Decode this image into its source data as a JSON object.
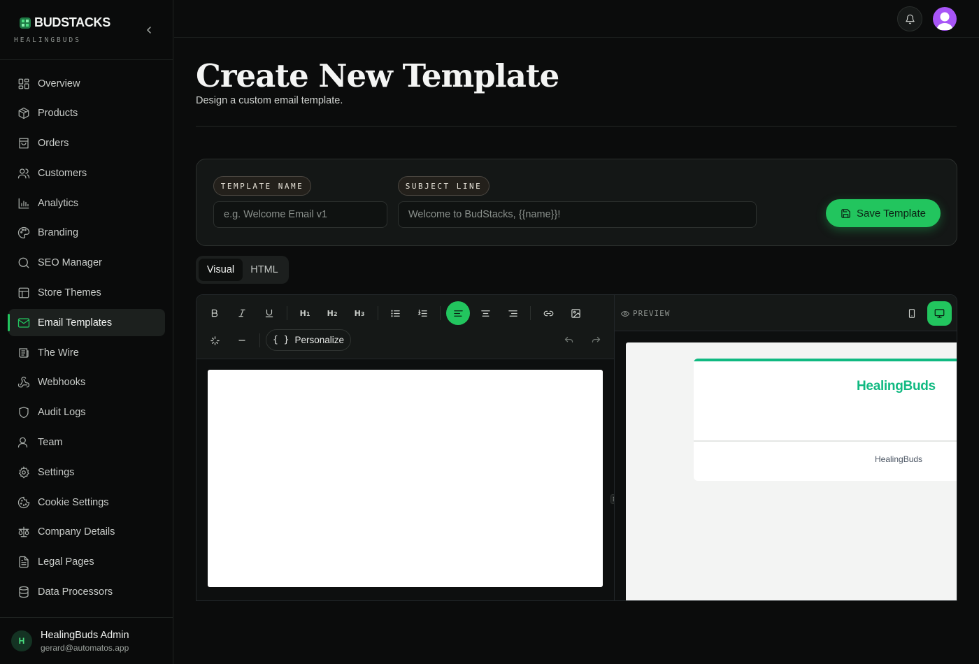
{
  "brand": {
    "name": "BUDSTACKS",
    "subtitle": "HEALINGBUDS"
  },
  "sidebar": {
    "items": [
      {
        "label": "Overview",
        "icon": "grid-icon"
      },
      {
        "label": "Products",
        "icon": "box-icon"
      },
      {
        "label": "Orders",
        "icon": "bag-icon"
      },
      {
        "label": "Customers",
        "icon": "users-icon"
      },
      {
        "label": "Analytics",
        "icon": "bar-chart-icon"
      },
      {
        "label": "Branding",
        "icon": "palette-icon"
      },
      {
        "label": "SEO Manager",
        "icon": "search-icon"
      },
      {
        "label": "Store Themes",
        "icon": "layout-icon"
      },
      {
        "label": "Email Templates",
        "icon": "mail-icon",
        "active": true
      },
      {
        "label": "The Wire",
        "icon": "newspaper-icon"
      },
      {
        "label": "Webhooks",
        "icon": "webhook-icon"
      },
      {
        "label": "Audit Logs",
        "icon": "shield-icon"
      },
      {
        "label": "Team",
        "icon": "user-icon"
      },
      {
        "label": "Settings",
        "icon": "gear-icon"
      },
      {
        "label": "Cookie Settings",
        "icon": "cookie-icon"
      },
      {
        "label": "Company Details",
        "icon": "scale-icon"
      },
      {
        "label": "Legal Pages",
        "icon": "file-text-icon"
      },
      {
        "label": "Data Processors",
        "icon": "database-icon"
      }
    ]
  },
  "user": {
    "initial": "H",
    "name": "HealingBuds Admin",
    "email": "gerard@automatos.app"
  },
  "page": {
    "title": "Create New Template",
    "subtitle": "Design a custom email template."
  },
  "form": {
    "template_name_label": "TEMPLATE NAME",
    "template_name_placeholder": "e.g. Welcome Email v1",
    "template_name_value": "",
    "subject_label": "SUBJECT LINE",
    "subject_placeholder": "Welcome to BudStacks, {{name}}!",
    "subject_value": "",
    "save_label": "Save Template"
  },
  "mode_tabs": {
    "visual": "Visual",
    "html": "HTML",
    "active": "Visual"
  },
  "toolbar": {
    "h1": "H",
    "h1_sub": "1",
    "h2": "H",
    "h2_sub": "2",
    "h3": "H",
    "h3_sub": "3",
    "personalize_braces": "{ }",
    "personalize_label": "Personalize",
    "active_alignment": "left"
  },
  "preview": {
    "label": "PREVIEW",
    "active_device": "desktop",
    "email_brand": "HealingBuds",
    "email_footer": "HealingBuds"
  },
  "colors": {
    "accent": "#22c55e",
    "email_brand": "#10b981",
    "avatar": "#a855f7"
  }
}
